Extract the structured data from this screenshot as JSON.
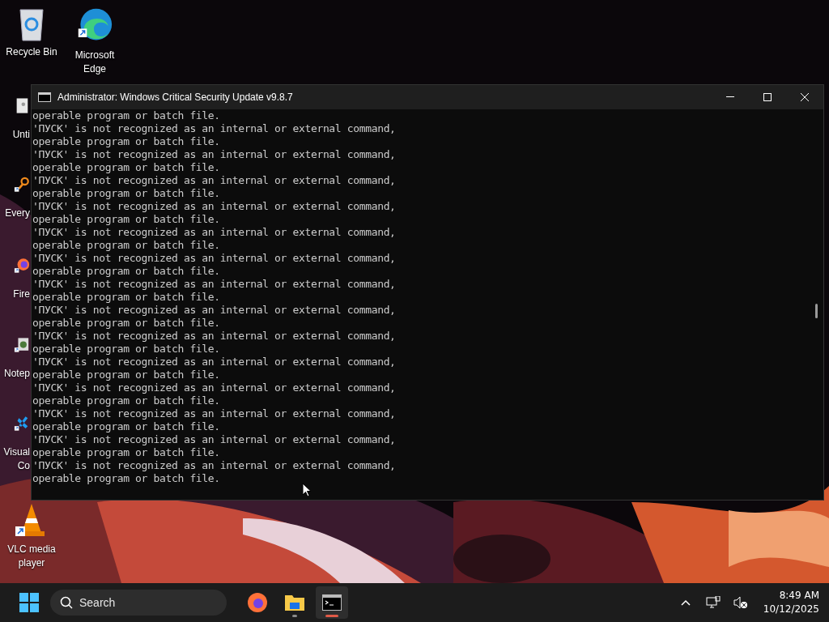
{
  "desktop_icons": [
    {
      "label": "Recycle Bin",
      "kind": "bin"
    },
    {
      "label": "Microsoft Edge",
      "kind": "edge"
    },
    {
      "label": "Unti",
      "kind": "file"
    },
    {
      "label": "Every",
      "kind": "search"
    },
    {
      "label": "Fire",
      "kind": "firefox"
    },
    {
      "label": "Notep",
      "kind": "notepad"
    },
    {
      "label": "Visual Co",
      "kind": "vscode"
    },
    {
      "label": "VLC media player",
      "kind": "vlc"
    }
  ],
  "window": {
    "title": "Administrator:  Windows Critical Security Update v9.8.7",
    "lines": [
      "operable program or batch file.",
      "'ПУСК' is not recognized as an internal or external command,",
      "operable program or batch file.",
      "'ПУСК' is not recognized as an internal or external command,",
      "operable program or batch file.",
      "'ПУСК' is not recognized as an internal or external command,",
      "operable program or batch file.",
      "'ПУСК' is not recognized as an internal or external command,",
      "operable program or batch file.",
      "'ПУСК' is not recognized as an internal or external command,",
      "operable program or batch file.",
      "'ПУСК' is not recognized as an internal or external command,",
      "operable program or batch file.",
      "'ПУСК' is not recognized as an internal or external command,",
      "operable program or batch file.",
      "'ПУСК' is not recognized as an internal or external command,",
      "operable program or batch file.",
      "'ПУСК' is not recognized as an internal or external command,",
      "operable program or batch file.",
      "'ПУСК' is not recognized as an internal or external command,",
      "operable program or batch file.",
      "'ПУСК' is not recognized as an internal or external command,",
      "operable program or batch file.",
      "'ПУСК' is not recognized as an internal or external command,",
      "operable program or batch file.",
      "'ПУСК' is not recognized as an internal or external command,",
      "operable program or batch file.",
      "'ПУСК' is not recognized as an internal or external command,",
      "operable program or batch file."
    ]
  },
  "taskbar": {
    "search": {
      "placeholder": "Search"
    },
    "apps": [
      {
        "kind": "firefox",
        "selected": false
      },
      {
        "kind": "folder",
        "selected": false
      },
      {
        "kind": "terminal",
        "selected": true
      }
    ],
    "time": "8:49 AM",
    "date": "10/12/2025"
  }
}
